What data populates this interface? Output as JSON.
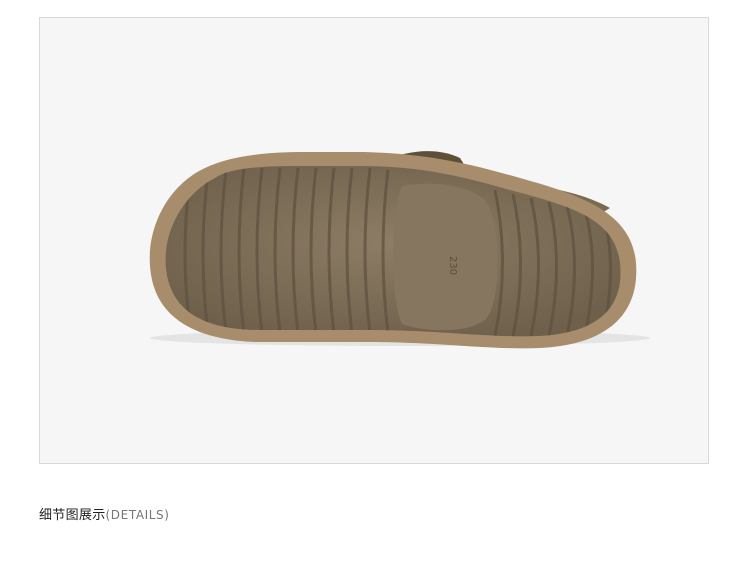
{
  "product_image": {
    "size_mark": "230",
    "colors": {
      "background": "#f6f6f6",
      "frame_border": "#d9d9d9",
      "outsole": "#86765f",
      "outsole_dark": "#6f604b",
      "midsole": "#a88d6c",
      "strap": "#5e5038"
    }
  },
  "caption": {
    "title": "细节图展示",
    "subtitle": "(DETAILS)"
  }
}
